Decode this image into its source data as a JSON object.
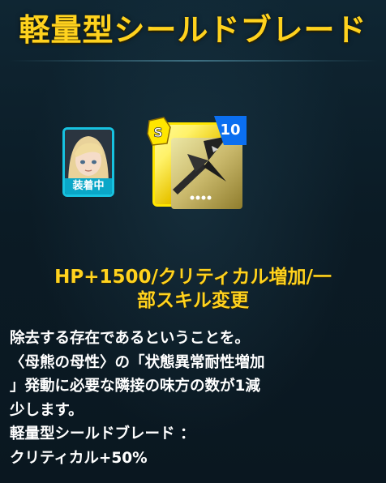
{
  "header": {
    "title": "軽量型シールドブレード"
  },
  "character": {
    "status_label": "装着中"
  },
  "equipment": {
    "level": "10",
    "rarity_tag": "S"
  },
  "effect": {
    "stat_line1": "HP+1500/クリティカル増加/一",
    "stat_line2": "部スキル変更"
  },
  "description": {
    "lines": [
      "除去する存在であるということを。",
      "〈母熊の母性〉の「状態異常耐性増加",
      "」発動に必要な隣接の味方の数が1減",
      "少します。",
      "軽量型シールドブレード ：",
      "クリティカル+50%"
    ]
  },
  "colors": {
    "title": "#ffd21e",
    "accent_cyan": "#17c2e0",
    "badge_blue": "#0b6ff0",
    "card_gold": "#ffe600"
  }
}
